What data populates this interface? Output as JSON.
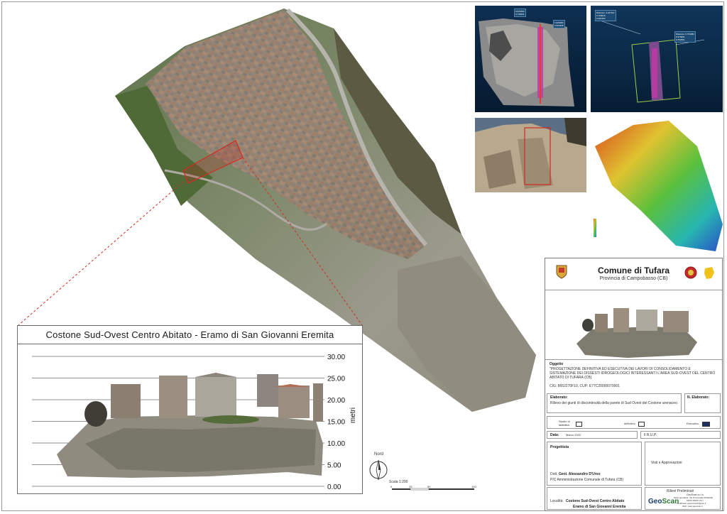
{
  "section": {
    "title": "Costone Sud-Ovest Centro Abitato  -  Eramo di San Giovanni Eremita",
    "y_axis_label": "metri",
    "y_ticks": [
      "30.00",
      "25.00",
      "20.00",
      "15.00",
      "10.00",
      "5.00",
      "0.00"
    ]
  },
  "north": {
    "label": "Nord"
  },
  "scale": {
    "label": "Scala 1:200",
    "ticks": [
      "0",
      "25",
      "50",
      "100"
    ]
  },
  "pointcloud": {
    "legend_1": [
      "0.621684",
      "0.745231",
      "1.026483",
      "0.954338",
      "0.879842",
      "1.409450"
    ],
    "legend_2_title": "Distance: 4.227617",
    "legend_2": [
      "0.729015",
      "0.461302",
      "0.126980",
      "0.918656",
      "0.418083",
      "1.406643"
    ],
    "legend_3_title": "Distance: 0.734084",
    "legend_3": [
      "0.376601",
      "0.752091",
      "0.782302",
      "0.464997",
      "0.398666",
      "0.482991"
    ]
  },
  "cartouche": {
    "comune": "Comune di Tufara",
    "provincia": "Provincia di Campobasso (CB)",
    "oggetto_label": "Oggetto",
    "oggetto_text": "\"PROGETTAZIONE DEFINITIVA ED ESECUTIVA DEI LAVORI DI CONSOLIDAMENTO E SISTEMAZIONE DEI DISSESTI IDROGEOLOGICI INTERESSANTI L'AREA SUD-OVEST DEL CENTRO ABITATO DI TUFARA (CB).",
    "cig": "CIG: 8652270F10, CUP: E77C20000070001",
    "elaborato_label": "Elaborato:",
    "elaborato_text": "Rilievo dei giunti di discontinuità della parete di  Sud Ovest del Costone arenaceo.",
    "n_elaborato_label": "N. Elaborato:",
    "fase_studio": "Studio di fattibilità",
    "fase_definitivo": "definitivo",
    "fase_esecutivo": "Esecutivo",
    "data_label": "Data:",
    "data_value": "Marzo 2022",
    "rup_label": "Il R.U.P.",
    "progettista_label": "Progettista",
    "progettista_prefix": "Dott.",
    "progettista_name": "Geol. Alessandro D'Urso",
    "progettista_role": "P/C Amministrazione Comunale di Tufara (CB)",
    "visti_label": "Visti e Approvazioni",
    "rilievi_label": "Rilievi Preliminari",
    "company_name": "GeoScan s.r.l.s.",
    "company_line1": "Sede operativa: Via Provinciale 9/Sabella",
    "company_line2": "93016 RIESI (CL)",
    "company_line3": "Certificata: geoscanscrl@pec.it",
    "company_line4": "Web: www.geoscan.it",
    "logo_text_geo": "Geo",
    "logo_text_scan": "Scan",
    "localita_label": "Località:",
    "localita_line1": "Costone Sud-Ovest Centro Abitato",
    "localita_line2": "Eramo di San Giovanni Eremita"
  },
  "colors": {
    "red_outline": "#d42a1f",
    "title_text": "#1a1a1a",
    "dem_high": "#d94a1f",
    "dem_low": "#2a4fc9"
  }
}
